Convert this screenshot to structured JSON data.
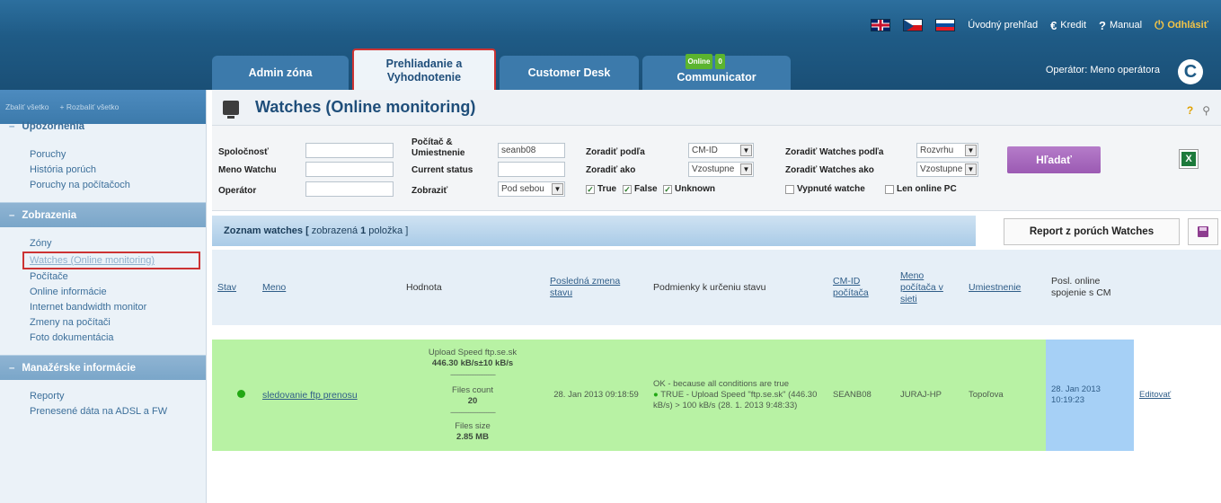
{
  "header": {
    "util_links": [
      {
        "label": "Úvodný prehľad"
      },
      {
        "icon": "€",
        "label": "Kredit"
      },
      {
        "icon": "?",
        "label": "Manual"
      },
      {
        "icon": "⏻",
        "label": "Odhlásiť"
      }
    ],
    "tabs": [
      {
        "label": "Admin zóna"
      },
      {
        "label": "Prehliadanie a Vyhodnotenie"
      },
      {
        "label": "Customer Desk"
      },
      {
        "label": "Communicator",
        "badge_status": "Online",
        "badge_count": "0"
      }
    ],
    "operator": "Operátor: Meno operátora",
    "logo_letter": "C"
  },
  "sidebar": {
    "collapse_all": "Zbaliť všetko",
    "expand_all": "+ Rozbaliť všetko",
    "sections": [
      {
        "title": "Upozornenia",
        "items": [
          "Poruchy",
          "História porúch",
          "Poruchy na počítačoch"
        ]
      },
      {
        "title": "Zobrazenia",
        "items": [
          "Zóny",
          "Watches (Online monitoring)",
          "Počítače",
          "Online informácie",
          "Internet bandwidth monitor",
          "Zmeny na počítači",
          "Foto dokumentácia"
        ]
      },
      {
        "title": "Manažérske informácie",
        "items": [
          "Reporty",
          "Prenesené dáta na ADSL a FW"
        ]
      }
    ]
  },
  "main": {
    "title": "Watches (Online monitoring)",
    "help_icon": "?",
    "filters": {
      "company_label": "Spoločnosť",
      "computer_label": "Počítač & Umiestnenie",
      "computer_value": "seanb08",
      "sort_by_label": "Zoradiť podľa",
      "sort_by_value": "CM-ID",
      "sort_watches_by_label": "Zoradiť Watches podľa",
      "sort_watches_by_value": "Rozvrhu",
      "watch_name_label": "Meno Watchu",
      "status_label": "Current status",
      "sort_as_label": "Zoradiť ako",
      "sort_as_value": "Vzostupne",
      "sort_watches_as_label": "Zoradiť Watches ako",
      "sort_watches_as_value": "Vzostupne",
      "operator_label": "Operátor",
      "show_label": "Zobraziť",
      "show_value": "Pod sebou",
      "cb_true": "True",
      "cb_false": "False",
      "cb_unknown": "Unknown",
      "cb_disabled": "Vypnuté watche",
      "cb_online": "Len online PC",
      "search_button": "Hľadať"
    },
    "list": {
      "title_prefix": "Zoznam watches [",
      "title_mid": "zobrazená",
      "count": "1",
      "title_suffix": "položka ]",
      "report_button": "Report z porúch Watches"
    },
    "columns": [
      "Stav",
      "Meno",
      "Hodnota",
      "Posledná zmena stavu",
      "Podmienky k určeniu stavu",
      "CM-ID počítača",
      "Meno počítača v sieti",
      "Umiestnenie",
      "Posl. online spojenie s CM",
      ""
    ],
    "rows": [
      {
        "name": "sledovanie ftp prenosu",
        "value_1_label": "Upload Speed ftp.se.sk",
        "value_1": "446.30 kB/s±10 kB/s",
        "value_sep": "-------------------------",
        "value_2_label": "Files count",
        "value_2": "20",
        "value_3_label": "Files size",
        "value_3": "2.85 MB",
        "last_change": "28. Jan 2013 09:18:59",
        "condition_header": "OK - because all conditions are true",
        "condition_detail": "TRUE - Upload Speed \"ftp.se.sk\" (446.30 kB/s) > 100 kB/s (28. 1. 2013 9:48:33)",
        "cm_id": "SEANB08",
        "pc_name": "JURAJ-HP",
        "location": "Topoľova",
        "last_online": "28. Jan 2013 10:19:23",
        "edit": "Editovať"
      }
    ]
  }
}
